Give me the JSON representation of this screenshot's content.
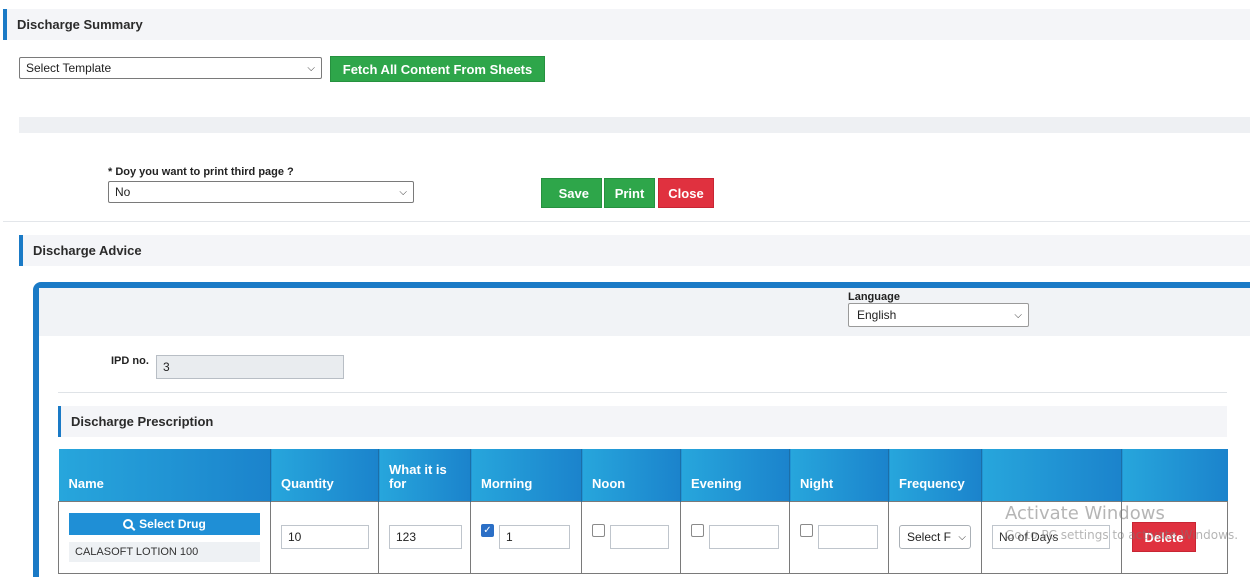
{
  "discharge_summary": {
    "title": "Discharge Summary",
    "template_select": "Select Template",
    "fetch_button": "Fetch All Content From Sheets",
    "print_third_page_label": "* Doy you want to print third page ?",
    "print_third_page_value": "No",
    "save_button": "Save",
    "print_button": "Print",
    "close_button": "Close"
  },
  "discharge_advice": {
    "title": "Discharge Advice",
    "language_label": "Language",
    "language_value": "English",
    "ipd_label": "IPD no.",
    "ipd_value": "3"
  },
  "prescription": {
    "title": "Discharge Prescription",
    "columns": [
      "Name",
      "Quantity",
      "What it is for",
      "Morning",
      "Noon",
      "Evening",
      "Night",
      "Frequency",
      "",
      ""
    ],
    "row": {
      "select_drug_label": "Select Drug",
      "drug_name": "CALASOFT LOTION 100",
      "quantity": "10",
      "what_for": "123",
      "morning_checked": true,
      "morning_value": "1",
      "noon_checked": false,
      "noon_value": "",
      "evening_checked": false,
      "evening_value": "",
      "night_checked": false,
      "night_value": "",
      "frequency_select": "Select F",
      "days_placeholder": "No of Days",
      "delete_button": "Delete"
    }
  },
  "watermark": {
    "line1": "Activate Windows",
    "line2": "Go to PC settings to activate Windows."
  },
  "colors": {
    "accent_blue": "#1a7ac6",
    "green": "#2ea64a",
    "red": "#e0313f"
  }
}
